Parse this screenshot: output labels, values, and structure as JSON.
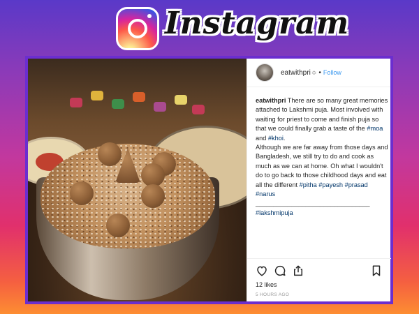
{
  "banner": {
    "brand_name": "Instagram",
    "logo_icon": "instagram-logo-icon"
  },
  "post": {
    "header": {
      "username": "eatwithpri",
      "selector_glyph": "≎",
      "separator": "•",
      "follow_label": "Follow"
    },
    "caption": {
      "author": "eatwithpri",
      "part1": " There are so many great memories attached to Lakshmi puja. Most involved with waiting for priest to come and finish puja so that we could finally grab a taste of the ",
      "tag_moa": "#moa",
      "and1": " and ",
      "tag_khoi": "#khoi",
      "part1_end": ".",
      "part2": "Although we are far away from those days and Bangladesh, we still try to do and cook as much as we can at home. Oh what I wouldn't do to go back to those childhood days and eat all the different ",
      "tag_pitha": "#pitha",
      "sp1": " ",
      "tag_payesh": "#payesh",
      "sp2": " ",
      "tag_prasad": "#prasad",
      "sp3": " ",
      "tag_narus": "#narus",
      "rule": "________________________________",
      "tag_lakshmipuja": "#lakshmipuja"
    },
    "actions": {
      "like_icon": "heart-icon",
      "comment_icon": "comment-icon",
      "share_icon": "share-icon",
      "save_icon": "bookmark-icon"
    },
    "likes": "12 likes",
    "timestamp": "5 HOURS AGO"
  },
  "colors": {
    "accent_link": "#3897f0",
    "hashtag": "#003569",
    "frame": "#6b2ecf"
  }
}
